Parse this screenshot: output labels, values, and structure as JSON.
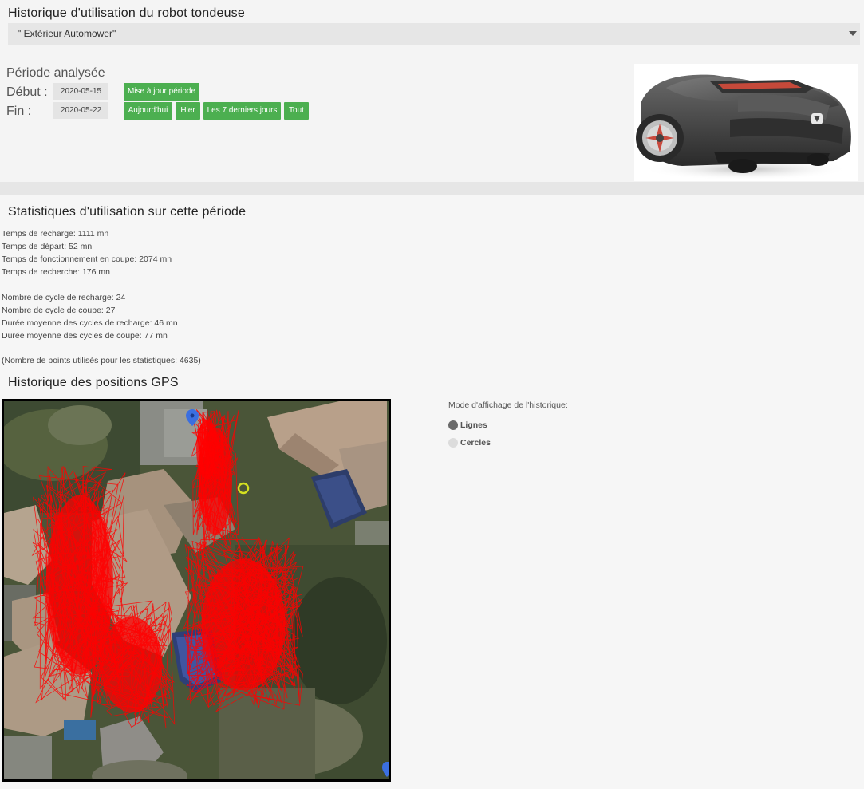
{
  "header": {
    "title": "Historique d'utilisation du robot tondeuse",
    "selected_device": "\" Extérieur Automower\""
  },
  "period": {
    "title": "Période analysée",
    "start_label": "Début :",
    "end_label": "Fin :",
    "start_date": "2020-05-15",
    "end_date": "2020-05-22",
    "buttons": {
      "update": "Mise à jour période",
      "today": "Aujourd'hui",
      "yesterday": "Hier",
      "last7": "Les 7 derniers jours",
      "all": "Tout"
    }
  },
  "stats": {
    "title": "Statistiques d'utilisation sur cette période",
    "lines": [
      "Temps de recharge: 1111 mn",
      "Temps de départ: 52 mn",
      "Temps de fonctionnement en coupe: 2074 mn",
      "Temps de recherche: 176 mn",
      "Nombre de cycle de recharge: 24",
      "Nombre de cycle de coupe: 27",
      "Durée moyenne des cycles de recharge: 46 mn",
      "Durée moyenne des cycles de coupe: 77 mn",
      "(Nombre de points utilisés pour les statistiques: 4635)"
    ]
  },
  "gps": {
    "title": "Historique des positions GPS",
    "mode_title": "Mode d'affichage de l'historique:",
    "modes": [
      {
        "label": "Lignes",
        "selected": true
      },
      {
        "label": "Cercles",
        "selected": false
      }
    ]
  },
  "colors": {
    "button_green": "#4caf50",
    "track_red": "#ff0000",
    "position_marker": "#d4e020",
    "pin_blue": "#3b6fe0"
  }
}
